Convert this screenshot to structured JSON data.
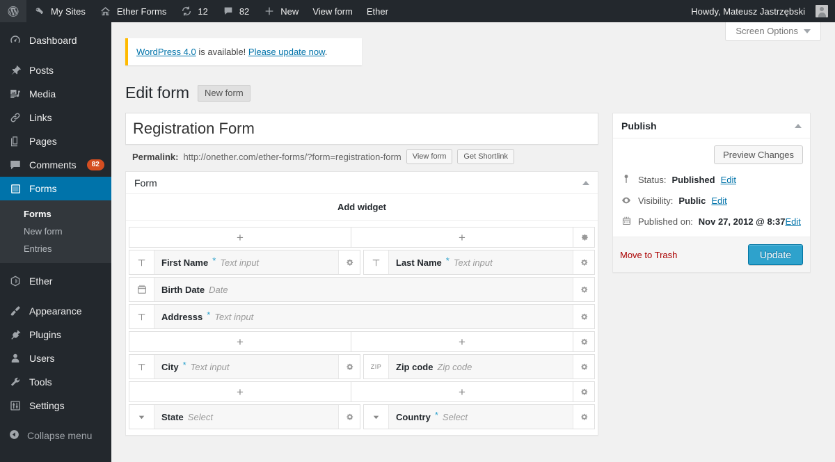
{
  "adminbar": {
    "left_items": [
      {
        "icon": "wordpress-logo-icon",
        "label": ""
      },
      {
        "icon": "key-icon",
        "label": "My Sites"
      },
      {
        "icon": "home-icon",
        "label": "Ether Forms"
      },
      {
        "icon": "updates-icon",
        "label": "12"
      },
      {
        "icon": "comment-bubble-icon",
        "label": "82"
      },
      {
        "icon": "plus-icon",
        "label": "New"
      },
      {
        "icon": "",
        "label": "View form"
      },
      {
        "icon": "",
        "label": "Ether"
      }
    ],
    "howdy": "Howdy, Mateusz Jastrzębski"
  },
  "sidebar": {
    "items": [
      {
        "label": "Dashboard",
        "icon": "dashboard-icon",
        "current": false,
        "badge": ""
      },
      {
        "label": "Posts",
        "icon": "pin-icon",
        "current": false,
        "badge": ""
      },
      {
        "label": "Media",
        "icon": "media-icon",
        "current": false,
        "badge": ""
      },
      {
        "label": "Links",
        "icon": "link-icon",
        "current": false,
        "badge": ""
      },
      {
        "label": "Pages",
        "icon": "pages-icon",
        "current": false,
        "badge": ""
      },
      {
        "label": "Comments",
        "icon": "comment-bubble-icon",
        "current": false,
        "badge": "82"
      },
      {
        "label": "Forms",
        "icon": "forms-icon",
        "current": true,
        "badge": ""
      }
    ],
    "submenu": [
      {
        "label": "Forms",
        "current": true
      },
      {
        "label": "New form",
        "current": false
      },
      {
        "label": "Entries",
        "current": false
      }
    ],
    "items2": [
      {
        "label": "Ether",
        "icon": "ether-icon"
      },
      {
        "label": "Appearance",
        "icon": "brush-icon"
      },
      {
        "label": "Plugins",
        "icon": "plug-icon"
      },
      {
        "label": "Users",
        "icon": "user-icon"
      },
      {
        "label": "Tools",
        "icon": "wrench-icon"
      },
      {
        "label": "Settings",
        "icon": "sliders-icon"
      }
    ],
    "collapse": "Collapse menu"
  },
  "screen_options": "Screen Options",
  "notice": {
    "link_version": "WordPress 4.0",
    "mid_text": " is available! ",
    "link_update": "Please update now",
    "end_text": "."
  },
  "page": {
    "title": "Edit form",
    "action_button": "New form"
  },
  "titlebox": {
    "title_value": "Registration Form",
    "title_placeholder": "Enter title here",
    "permalink_label": "Permalink:",
    "permalink_url": "http://onether.com/ether-forms/?form=registration-form",
    "view_button": "View form",
    "shortlink_button": "Get Shortlink"
  },
  "formbox": {
    "header": "Form",
    "add_widget": "Add widget",
    "rows": [
      {
        "type": "addbar",
        "columns": 2
      },
      {
        "type": "fields",
        "fields": [
          {
            "icon": "text-input-icon",
            "label": "First Name",
            "required": true,
            "placeholder": "Text input"
          },
          {
            "icon": "text-input-icon",
            "label": "Last Name",
            "required": true,
            "placeholder": "Text input"
          }
        ]
      },
      {
        "type": "fields",
        "fields": [
          {
            "icon": "calendar-icon",
            "label": "Birth Date",
            "required": false,
            "placeholder": "Date"
          }
        ]
      },
      {
        "type": "fields",
        "fields": [
          {
            "icon": "text-input-icon",
            "label": "Addresss",
            "required": true,
            "placeholder": "Text input"
          }
        ]
      },
      {
        "type": "addbar",
        "columns": 2
      },
      {
        "type": "fields",
        "fields": [
          {
            "icon": "text-input-icon",
            "label": "City",
            "required": true,
            "placeholder": "Text input"
          },
          {
            "icon": "zip-icon",
            "label": "Zip code",
            "required": false,
            "placeholder": "Zip code"
          }
        ]
      },
      {
        "type": "addbar",
        "columns": 2
      },
      {
        "type": "fields",
        "fields": [
          {
            "icon": "select-icon",
            "label": "State",
            "required": false,
            "placeholder": "Select"
          },
          {
            "icon": "select-icon",
            "label": "Country",
            "required": true,
            "placeholder": "Select"
          }
        ]
      }
    ]
  },
  "publish": {
    "header": "Publish",
    "preview_button": "Preview Changes",
    "status_label": "Status:",
    "status_value": "Published",
    "status_edit": "Edit",
    "visibility_label": "Visibility:",
    "visibility_value": "Public",
    "visibility_edit": "Edit",
    "published_label": "Published on:",
    "published_value": "Nov 27, 2012 @ 8:37",
    "published_edit": "Edit",
    "trash": "Move to Trash",
    "update_button": "Update"
  },
  "colors": {
    "adminbar_bg": "#23282d",
    "sidebar_bg": "#23282d",
    "submenu_bg": "#32373c",
    "current_menu": "#0073aa",
    "content_bg": "#f1f1f1",
    "accent_blue": "#2ea2cc",
    "link_blue": "#0073aa",
    "notice_border": "#ffba00",
    "badge_orange": "#d54e21",
    "trash_red": "#a00",
    "required_star": "#2ea2cc"
  }
}
